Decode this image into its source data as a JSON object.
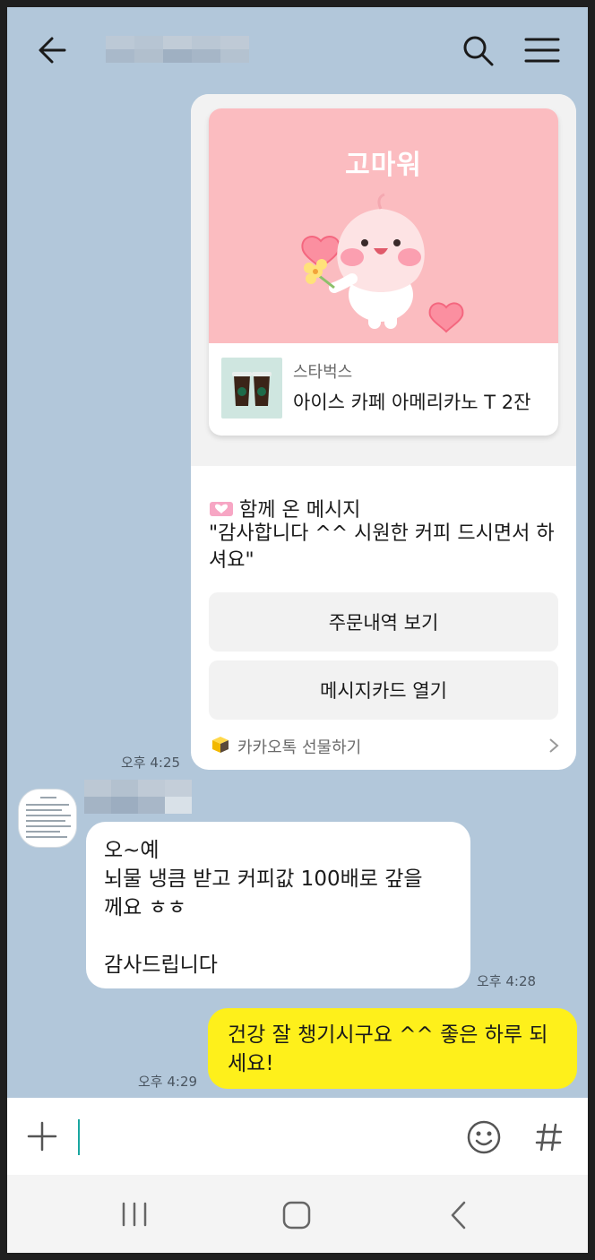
{
  "header": {
    "back_icon": "arrow-left-icon",
    "search_icon": "search-icon",
    "menu_icon": "hamburger-menu-icon"
  },
  "gift": {
    "art_title": "고마워",
    "brand": "스타벅스",
    "product_name": "아이스 카페 아메리카노 T 2잔",
    "message_heading": "함께 온 메시지",
    "message_body": "\"감사합니다 ^^ 시원한 커피 드시면서 하셔요\"",
    "buttons": {
      "order_history": "주문내역 보기",
      "open_message_card": "메시지카드 열기"
    },
    "footer_label": "카카오톡 선물하기",
    "time": "오후 4:25"
  },
  "received": {
    "text": "오~예\n뇌물 냉큼 받고 커피값 100배로 갚을\n께요 ㅎㅎ\n\n감사드립니다",
    "time": "오후 4:28"
  },
  "sent": {
    "text": "건강 잘 챙기시구요 ^^ 좋은 하루 되세요!",
    "time": "오후 4:29"
  },
  "input": {
    "value": "",
    "plus_icon": "plus-icon",
    "emoji_icon": "emoji-icon",
    "hash_icon": "hash-icon"
  },
  "colors": {
    "chat_background": "#b2c7da",
    "sent_bubble": "#fef01b",
    "gift_art": "#fbbcc0"
  }
}
